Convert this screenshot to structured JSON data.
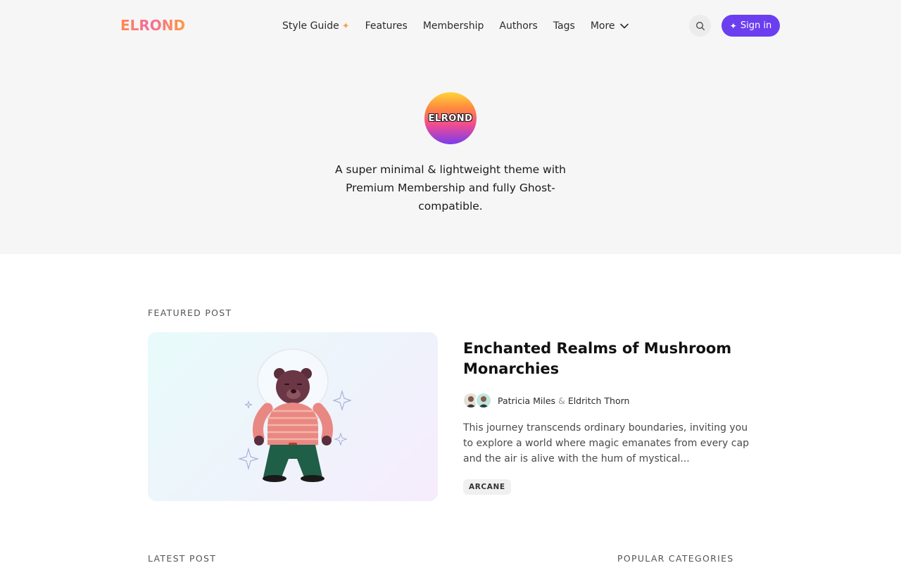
{
  "header": {
    "logo_text": "ELROND",
    "nav": [
      {
        "label": "Style Guide"
      },
      {
        "label": "Features"
      },
      {
        "label": "Membership"
      },
      {
        "label": "Authors"
      },
      {
        "label": "Tags"
      },
      {
        "label": "More"
      }
    ],
    "signin_label": "Sign in",
    "accent_color": "#6b3ef0"
  },
  "hero": {
    "logo_text": "ELROND",
    "tagline": "A super minimal & lightweight theme with Premium Membership and fully Ghost-compatible."
  },
  "featured": {
    "section_label": "FEATURED POST",
    "title": "Enchanted Realms of Mushroom Monarchies",
    "authors": [
      "Patricia Miles",
      "Eldritch Thorn"
    ],
    "author_separator": "&",
    "excerpt": "This journey transcends ordinary boundaries, inviting you to explore a world where magic emanates from every cap and the air is alive with the hum of mystical...",
    "tag": "ARCANE"
  },
  "sections": {
    "latest_label": "LATEST POST",
    "popular_label": "POPULAR CATEGORIES"
  }
}
